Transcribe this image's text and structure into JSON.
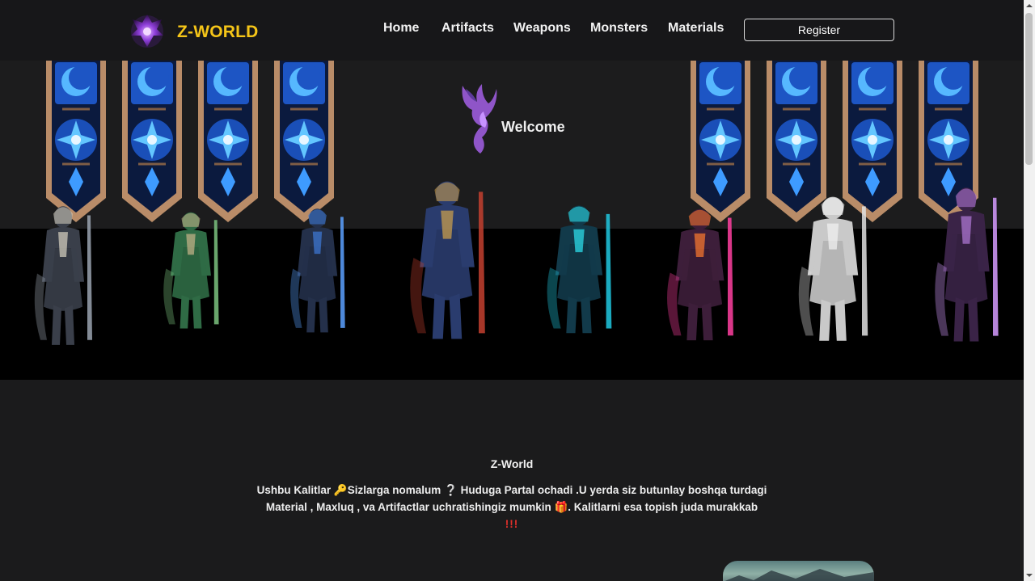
{
  "brand": {
    "name": "Z-WORLD",
    "logo_icon": "purple-dragon-emblem-icon",
    "color": "#f5c518"
  },
  "nav": {
    "items": [
      {
        "label": "Home"
      },
      {
        "label": "Artifacts"
      },
      {
        "label": "Weapons"
      },
      {
        "label": "Monsters"
      },
      {
        "label": "Materials"
      }
    ],
    "register_label": "Register"
  },
  "hero": {
    "welcome": "Welcome",
    "welcome_icon": "phoenix-icon",
    "banner_icon": "moon-banner-icon",
    "characters": [
      "hooded-assassin",
      "elf-archer",
      "dark-mage",
      "armored-knight",
      "cyan-wraith",
      "flame-swordswoman",
      "white-spear-warrior",
      "violet-sorceress"
    ]
  },
  "content": {
    "title": "Z-World",
    "text_1": "Ushbu Kalitlar",
    "emoji_key": "🔑",
    "text_2": "Sizlarga nomalum",
    "emoji_question": "❔",
    "text_3": "Huduga Partal ochadi .U yerda siz butunlay boshqa turdagi Material , Maxluq , va Artifactlar uchratishingiz mumkin",
    "emoji_gift": "🎁",
    "text_4": ". Kalitlarni esa topish juda murakkab",
    "bangs": "!!!"
  },
  "colors": {
    "accent": "#f5c518",
    "background": "#1b1b1c",
    "band": "#000000",
    "banner_blue": "#2f7dff",
    "banner_frame": "#c99a72"
  }
}
